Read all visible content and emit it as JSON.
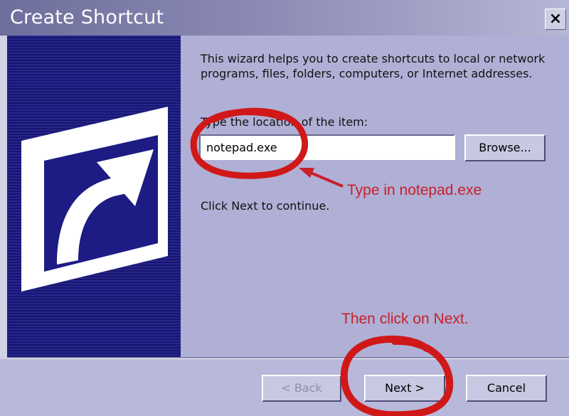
{
  "window": {
    "title": "Create Shortcut",
    "close_glyph": "×"
  },
  "content": {
    "intro": "This wizard helps you to create shortcuts to local or network programs, files, folders, computers, or Internet addresses.",
    "location_label": "Type the location of the item:",
    "location_value": "notepad.exe",
    "browse_label": "Browse...",
    "continue_text": "Click Next to continue."
  },
  "buttons": {
    "back_label": "< Back",
    "next_label": "Next >",
    "cancel_label": "Cancel"
  },
  "annotations": {
    "type_hint": "Type in notepad.exe",
    "next_hint": "Then click on Next.",
    "color": "#c8202a"
  },
  "icons": {
    "banner": "shortcut-arrow-icon",
    "close": "close-icon"
  },
  "colors": {
    "banner_bg": "#1c1c84",
    "dialog_bg": "#b0b0d6",
    "button_face": "#c8c8e2"
  }
}
